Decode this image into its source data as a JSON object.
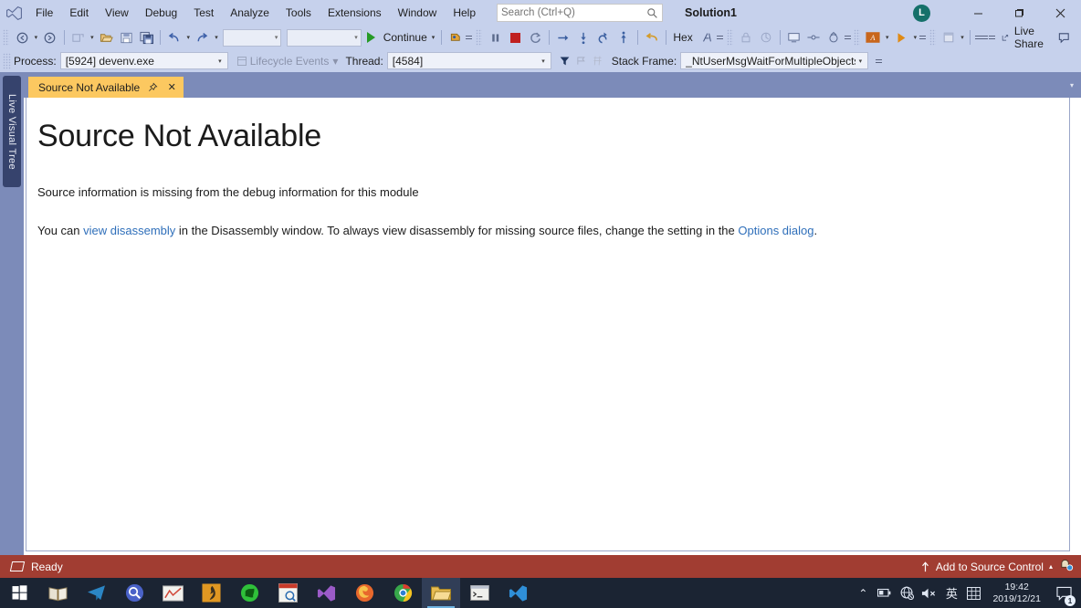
{
  "window": {
    "solution_title": "Solution1",
    "minimize_label": "–",
    "maximize_label": "❐",
    "close_label": "✕",
    "avatar_initial": "L"
  },
  "menubar": {
    "items": [
      {
        "label": "File",
        "name": "menu-file"
      },
      {
        "label": "Edit",
        "name": "menu-edit"
      },
      {
        "label": "View",
        "name": "menu-view"
      },
      {
        "label": "Debug",
        "name": "menu-debug"
      },
      {
        "label": "Test",
        "name": "menu-test"
      },
      {
        "label": "Analyze",
        "name": "menu-analyze"
      },
      {
        "label": "Tools",
        "name": "menu-tools"
      },
      {
        "label": "Extensions",
        "name": "menu-extensions"
      },
      {
        "label": "Window",
        "name": "menu-window"
      },
      {
        "label": "Help",
        "name": "menu-help"
      }
    ]
  },
  "search": {
    "placeholder": "Search (Ctrl+Q)",
    "value": "",
    "icon": "search-icon"
  },
  "toolbar": {
    "continue_label": "Continue",
    "hex_label": "Hex",
    "live_share_label": "Live Share",
    "combo1_value": "",
    "combo2_value": "",
    "caret": "▾"
  },
  "context_bar": {
    "process_label": "Process:",
    "process_value": "[5924] devenv.exe",
    "lifecycle_label": "Lifecycle Events",
    "thread_label": "Thread:",
    "thread_value": "[4584]",
    "stack_frame_label": "Stack Frame:",
    "stack_frame_value": "_NtUserMsgWaitForMultipleObjectsEx",
    "caret": "▾"
  },
  "dock": {
    "live_visual_tree_label": "Live Visual Tree"
  },
  "tabs": {
    "active": {
      "title": "Source Not Available",
      "pin_glyph": "⇥",
      "close_glyph": "✕"
    },
    "overflow_caret": "▾"
  },
  "editor": {
    "heading": "Source Not Available",
    "paragraph1": "Source information is missing from the debug information for this module",
    "paragraph2": {
      "part1": "You can ",
      "link1": "view disassembly",
      "part2": " in the Disassembly window. To always view disassembly for missing source files, change the setting in the ",
      "link2": "Options dialog",
      "part3": "."
    },
    "link_color": "#2f6fba"
  },
  "statusbar": {
    "status_text": "Ready",
    "source_control_label": "Add to Source Control",
    "caret": "▴",
    "background_color": "#a13d32"
  },
  "taskbar": {
    "items": [
      {
        "name": "taskbar-start",
        "glyph": "start"
      },
      {
        "name": "taskbar-book",
        "glyph": "book"
      },
      {
        "name": "taskbar-telegram",
        "glyph": "plane"
      },
      {
        "name": "taskbar-search-tool",
        "glyph": "magnifier"
      },
      {
        "name": "taskbar-chart-app",
        "glyph": "chart"
      },
      {
        "name": "taskbar-editor-app",
        "glyph": "flame"
      },
      {
        "name": "taskbar-green-app",
        "glyph": "globe-green"
      },
      {
        "name": "taskbar-calendar-app",
        "glyph": "calendar"
      },
      {
        "name": "taskbar-visual-studio",
        "glyph": "vs"
      },
      {
        "name": "taskbar-firefox",
        "glyph": "firefox"
      },
      {
        "name": "taskbar-chrome",
        "glyph": "chrome"
      },
      {
        "name": "taskbar-explorer",
        "glyph": "folder"
      },
      {
        "name": "taskbar-terminal",
        "glyph": "terminal"
      },
      {
        "name": "taskbar-vscode",
        "glyph": "vscode"
      }
    ],
    "tray": {
      "chevron": "⌃",
      "ime_label": "英",
      "time": "19:42",
      "date": "2019/12/21",
      "notification_count": "1"
    }
  }
}
